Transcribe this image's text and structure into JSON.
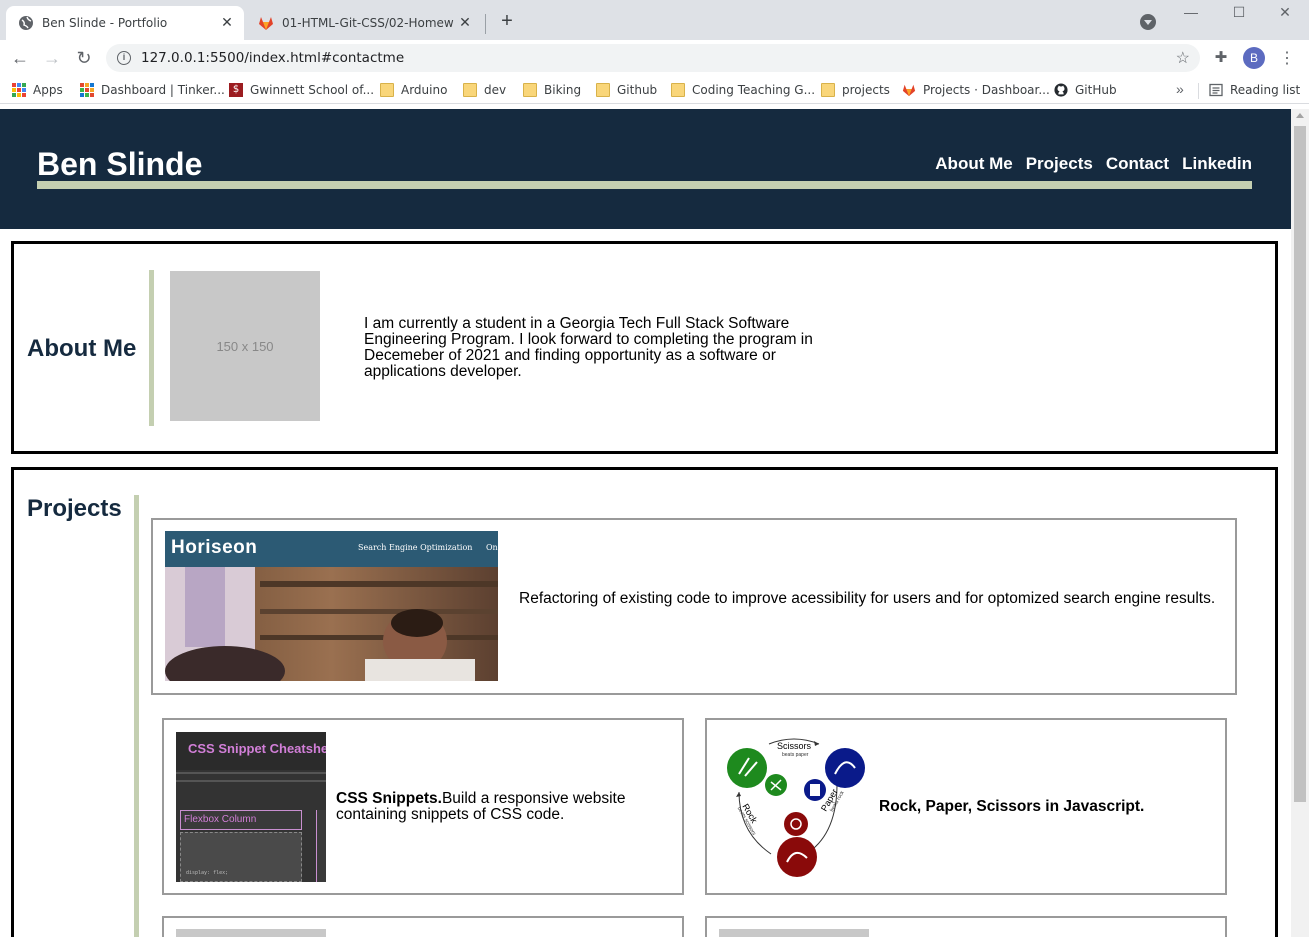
{
  "browser": {
    "tabs": [
      {
        "title": "Ben Slinde - Portfolio",
        "active": true
      },
      {
        "title": "01-HTML-Git-CSS/02-Homework",
        "active": false
      }
    ],
    "new_tab_glyph": "+",
    "close_glyph": "✕",
    "url": "127.0.0.1:5500/index.html#contactme",
    "profile_initial": "B",
    "bookmarks": [
      {
        "label": "Apps",
        "icon": "apps-grid-icon"
      },
      {
        "label": "Dashboard | Tinker...",
        "icon": "tinkercad-icon"
      },
      {
        "label": "Gwinnett School of...",
        "icon": "school-icon"
      },
      {
        "label": "Arduino",
        "icon": "folder-icon"
      },
      {
        "label": "dev",
        "icon": "folder-icon"
      },
      {
        "label": "Biking",
        "icon": "folder-icon"
      },
      {
        "label": "Github",
        "icon": "folder-icon"
      },
      {
        "label": "Coding Teaching G...",
        "icon": "folder-icon"
      },
      {
        "label": "projects",
        "icon": "folder-icon"
      },
      {
        "label": "Projects · Dashboar...",
        "icon": "gitlab-icon"
      },
      {
        "label": "GitHub",
        "icon": "github-icon"
      }
    ],
    "reading_list": "Reading list"
  },
  "site": {
    "title": "Ben Slinde",
    "nav": [
      "About Me",
      "Projects",
      "Contact",
      "Linkedin"
    ],
    "colors": {
      "header_bg": "#152a3f",
      "accent": "#c4cfb1"
    }
  },
  "about": {
    "heading": "About Me",
    "image_placeholder": "150 x 150",
    "text": "I am currently a student in a Georgia Tech Full Stack Software Engineering Program. I look forward to completing the program in Decemeber of 2021 and finding opportunity as a software or applications developer."
  },
  "projects": {
    "heading": "Projects",
    "horiseon": {
      "logo": "Horiseon",
      "menu": "Search Engine Optimization",
      "menu_partial": "On",
      "description": "Refactoring of existing code to improve acessibility for users and for optomized search engine results."
    },
    "css_snippets": {
      "image_title": "CSS Snippet Cheatsheet",
      "image_card": "Flexbox Column",
      "image_code": "display: flex;",
      "title": "CSS Snippets.",
      "description": "Build a responsive website containing snippets of CSS code."
    },
    "rps": {
      "diagram_labels": {
        "scissors": "Scissors",
        "scissors_sub": "beats paper",
        "paper": "Paper",
        "paper_sub": "beats rock",
        "rock": "Rock",
        "rock_sub": "beats scissors"
      },
      "title": "Rock, Paper, Scissors in Javascript."
    }
  }
}
